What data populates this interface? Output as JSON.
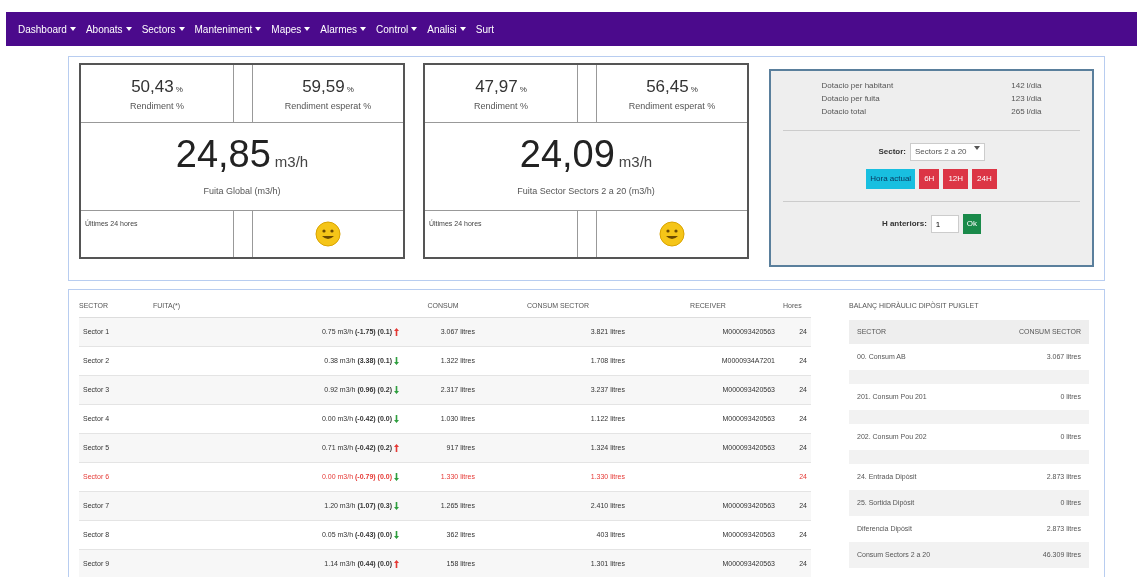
{
  "nav": [
    {
      "label": "Dashboard",
      "dropdown": true
    },
    {
      "label": "Abonats",
      "dropdown": true
    },
    {
      "label": "Sectors",
      "dropdown": true
    },
    {
      "label": "Manteniment",
      "dropdown": true
    },
    {
      "label": "Mapes",
      "dropdown": true
    },
    {
      "label": "Alarmes",
      "dropdown": true
    },
    {
      "label": "Control",
      "dropdown": true
    },
    {
      "label": "Analisi",
      "dropdown": true
    },
    {
      "label": "Surt",
      "dropdown": false
    }
  ],
  "cards": [
    {
      "rendiment": "50,43",
      "rendiment_unit": "%",
      "rendiment_label": "Rendiment %",
      "esperat": "59,59",
      "esperat_unit": "%",
      "esperat_label": "Rendiment esperat %",
      "value": "24,85",
      "unit": "m3/h",
      "caption": "Fuita Global (m3/h)",
      "footer": "Últimes 24 hores",
      "happy": true
    },
    {
      "rendiment": "47,97",
      "rendiment_unit": "%",
      "rendiment_label": "Rendiment %",
      "esperat": "56,45",
      "esperat_unit": "%",
      "esperat_label": "Rendiment esperat %",
      "value": "24,09",
      "unit": "m3/h",
      "caption": "Fuita Sector Sectors 2 a 20 (m3/h)",
      "footer": "Últimes 24 hores",
      "happy": true
    }
  ],
  "stats": {
    "rows": [
      {
        "label": "Dotacio per habitant",
        "value": "142 l/dia"
      },
      {
        "label": "Dotacio per fuita",
        "value": "123 l/dia"
      },
      {
        "label": "Dotacio total",
        "value": "265 l/dia"
      }
    ],
    "sector_label": "Sector:",
    "sector_value": "Sectors 2 a 20",
    "current_button": "Hora actual",
    "range_buttons": [
      "6H",
      "12H",
      "24H"
    ],
    "previous_label": "H anteriors:",
    "previous_value": "1",
    "ok_button": "Ok"
  },
  "table": {
    "columns": [
      "SECTOR",
      "FUITA(*)",
      "CONSUM",
      "CONSUM SECTOR",
      "RECEIVER",
      "Hores"
    ],
    "rows": [
      {
        "sector": "Sector 1",
        "fuita": "0.75 m3/h **(-1.75) (0.1)**",
        "rising": true,
        "consum": "3.067 litres",
        "consum_sector": "3.821 litres",
        "receiver": "M000093420563",
        "hores": "24",
        "alert": false
      },
      {
        "sector": "Sector 2",
        "fuita": "0.38 m3/h **(3.38) (0.1)**",
        "rising": false,
        "consum": "1.322 litres",
        "consum_sector": "1.708 litres",
        "receiver": "M0000934A7201",
        "hores": "24",
        "alert": false
      },
      {
        "sector": "Sector 3",
        "fuita": "0.92 m3/h **(0.96) (0.2)**",
        "rising": false,
        "consum": "2.317 litres",
        "consum_sector": "3.237 litres",
        "receiver": "M000093420563",
        "hores": "24",
        "alert": false
      },
      {
        "sector": "Sector 4",
        "fuita": "0.00 m3/h **(-0.42) (0.0)**",
        "rising": false,
        "consum": "1.030 litres",
        "consum_sector": "1.122 litres",
        "receiver": "M000093420563",
        "hores": "24",
        "alert": false
      },
      {
        "sector": "Sector 5",
        "fuita": "0.71 m3/h **(-0.42) (0.2)**",
        "rising": true,
        "consum": "917 litres",
        "consum_sector": "1.324 litres",
        "receiver": "M000093420563",
        "hores": "24",
        "alert": false
      },
      {
        "sector": "Sector 6",
        "fuita": "0.00 m3/h **(-0.79) (0.0)**",
        "rising": false,
        "consum": "1.330 litres",
        "consum_sector": "1.330 litres",
        "hores": "24",
        "alert": true
      },
      {
        "sector": "Sector 7",
        "fuita": "1.20 m3/h **(1.07) (0.3)**",
        "rising": false,
        "consum": "1.265 litres",
        "consum_sector": "2.410 litres",
        "receiver": "M000093420563",
        "hores": "24",
        "alert": false
      },
      {
        "sector": "Sector 8",
        "fuita": "0.05 m3/h **(-0.43) (0.0)**",
        "rising": false,
        "consum": "362 litres",
        "consum_sector": "403 litres",
        "receiver": "M000093420563",
        "hores": "24",
        "alert": false
      },
      {
        "sector": "Sector 9",
        "fuita": "1.14 m3/h **(0.44) (0.0)**",
        "rising": true,
        "consum": "158 litres",
        "consum_sector": "1.301 litres",
        "receiver": "M000093420563",
        "hores": "24",
        "alert": false
      }
    ]
  },
  "balance": {
    "title": "BALANÇ HIDRÀULIC DIPÒSIT PUIGLET",
    "columns": [
      "SECTOR",
      "CONSUM SECTOR"
    ],
    "rows": [
      {
        "kind": "data",
        "sector": "00. Consum AB",
        "consum": "3.067 litres"
      },
      {
        "kind": "spacer"
      },
      {
        "kind": "data",
        "sector": "201. Consum Pou 201",
        "consum": "0 litres"
      },
      {
        "kind": "spacer"
      },
      {
        "kind": "data",
        "sector": "202. Consum Pou 202",
        "consum": "0 litres"
      },
      {
        "kind": "spacer"
      },
      {
        "kind": "data",
        "sector": "24. Entrada Dipòsit",
        "consum": "2.873 litres"
      },
      {
        "kind": "data",
        "sector": "25. Sortida Dipòsit",
        "consum": "0 litres"
      },
      {
        "kind": "data",
        "sector": "Diferencia Dipòsit",
        "consum": "2.873 litres"
      },
      {
        "kind": "data",
        "sector": "Consum Sectors 2 a 20",
        "consum": "46.309 litres"
      }
    ]
  }
}
